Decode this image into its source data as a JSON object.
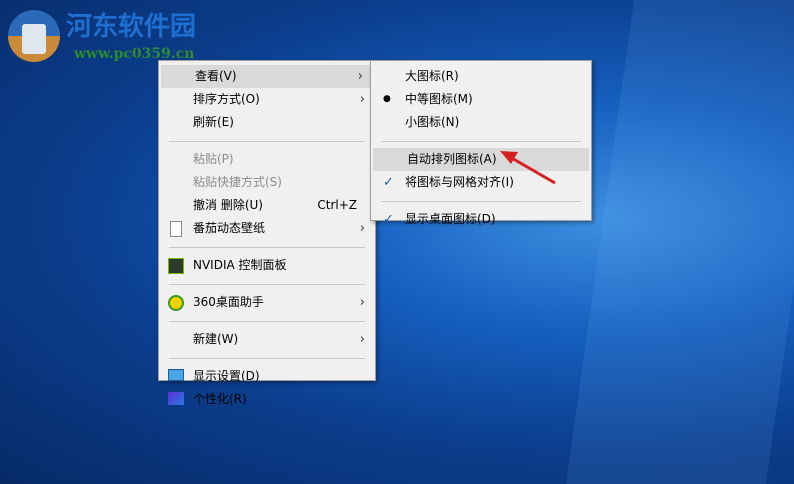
{
  "watermark": {
    "title": "河东软件园",
    "url": "www.pc0359.cn"
  },
  "main_menu": {
    "view": "查看(V)",
    "sort": "排序方式(O)",
    "refresh": "刷新(E)",
    "paste": "粘贴(P)",
    "paste_shortcut": "粘贴快捷方式(S)",
    "undo": "撤消 删除(U)",
    "undo_shortcut": "Ctrl+Z",
    "wallpaper": "番茄动态壁纸",
    "nvidia": "NVIDIA 控制面板",
    "assistant": "360桌面助手",
    "new": "新建(W)",
    "display": "显示设置(D)",
    "personalize": "个性化(R)"
  },
  "view_submenu": {
    "large": "大图标(R)",
    "medium": "中等图标(M)",
    "small": "小图标(N)",
    "auto_arrange": "自动排列图标(A)",
    "align_grid": "将图标与网格对齐(I)",
    "show_icons": "显示桌面图标(D)",
    "bullet": "●",
    "check": "✓"
  },
  "colors": {
    "arrow": "#d42020",
    "menu_bg": "#f0f0f0",
    "highlight": "#d9d9d9"
  }
}
